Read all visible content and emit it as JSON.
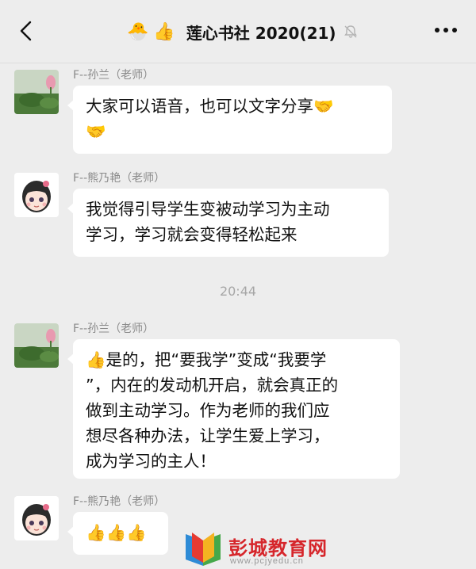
{
  "header": {
    "title": "莲心书社 2020(21)",
    "title_emojis": [
      "🐣",
      "👍"
    ],
    "back_icon": "chevron-left-icon",
    "mute_icon": "bell-slash-icon",
    "more_icon": "more-dots-icon"
  },
  "messages": [
    {
      "sender": "F--孙兰（老师）",
      "avatar": "lotus-avatar",
      "lines": [
        "大家可以语音，也可以文字分享🤝",
        "🤝"
      ]
    },
    {
      "sender": "F--熊乃艳（老师）",
      "avatar": "cartoon-girl-avatar",
      "lines": [
        "我觉得引导学生变被动学习为主动",
        "学习，学习就会变得轻松起来"
      ]
    },
    {
      "sender": "F--孙兰（老师）",
      "avatar": "lotus-avatar",
      "lines": [
        "👍是的，把“要我学”变成“我要学",
        "”，内在的发动机开启，就会真正的",
        "做到主动学习。作为老师的我们应",
        "想尽各种办法，让学生爱上学习，",
        "成为学习的主人！"
      ]
    },
    {
      "sender": "F--熊乃艳（老师）",
      "avatar": "cartoon-girl-avatar",
      "lines": [
        "👍👍👍"
      ]
    }
  ],
  "timestamp": "20:44",
  "watermark": {
    "name": "彭城教育网",
    "url": "www.pcjyedu.cn"
  },
  "colors": {
    "background": "#ededed",
    "bubble": "#ffffff",
    "sender_text": "#8a8a8a",
    "watermark_red": "#d6262b"
  }
}
